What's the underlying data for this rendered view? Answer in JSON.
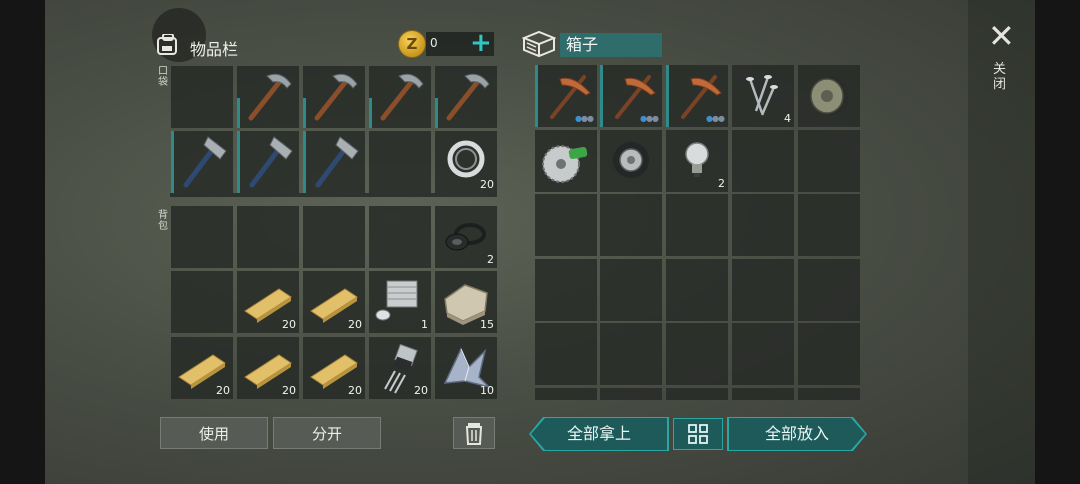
{
  "inventory": {
    "title": "物品栏",
    "coins": "0",
    "coin_symbol": "Z",
    "add_label": "+",
    "pocket_label": "口袋",
    "backpack_label": "背包",
    "use_label": "使用",
    "split_label": "分开",
    "pocket_slots": [
      {
        "icon": "empty-slot",
        "qty": ""
      },
      {
        "icon": "pickaxe-icon",
        "qty": ""
      },
      {
        "icon": "pickaxe-icon",
        "qty": ""
      },
      {
        "icon": "pickaxe-icon",
        "qty": ""
      },
      {
        "icon": "pickaxe-icon",
        "qty": ""
      },
      {
        "icon": "hatchet-icon",
        "qty": ""
      },
      {
        "icon": "hatchet-icon",
        "qty": ""
      },
      {
        "icon": "hatchet-icon",
        "qty": ""
      },
      {
        "icon": "empty-slot",
        "qty": ""
      },
      {
        "icon": "bearing-ring-icon",
        "qty": "20"
      }
    ],
    "backpack_slots": [
      {
        "icon": "empty-slot",
        "qty": ""
      },
      {
        "icon": "empty-slot",
        "qty": ""
      },
      {
        "icon": "empty-slot",
        "qty": ""
      },
      {
        "icon": "empty-slot",
        "qty": ""
      },
      {
        "icon": "rubber-seal-icon",
        "qty": "2"
      },
      {
        "icon": "empty-slot",
        "qty": ""
      },
      {
        "icon": "wood-plank-icon",
        "qty": "20"
      },
      {
        "icon": "wood-plank-icon",
        "qty": "20"
      },
      {
        "icon": "engine-cylinder-icon",
        "qty": "1"
      },
      {
        "icon": "stone-icon",
        "qty": "15"
      },
      {
        "icon": "wood-plank-icon",
        "qty": "20"
      },
      {
        "icon": "wood-plank-icon",
        "qty": "20"
      },
      {
        "icon": "wood-plank-icon",
        "qty": "20"
      },
      {
        "icon": "transistor-icon",
        "qty": "20"
      },
      {
        "icon": "metal-scrap-icon",
        "qty": "10"
      }
    ]
  },
  "box": {
    "title": "箱子",
    "take_all_label": "全部拿上",
    "put_all_label": "全部放入",
    "slots": [
      {
        "icon": "copper-pickaxe-icon",
        "qty": ""
      },
      {
        "icon": "copper-pickaxe-icon",
        "qty": ""
      },
      {
        "icon": "copper-pickaxe-icon",
        "qty": ""
      },
      {
        "icon": "nails-icon",
        "qty": "4"
      },
      {
        "icon": "brake-disc-icon",
        "qty": ""
      },
      {
        "icon": "saw-blade-icon",
        "qty": ""
      },
      {
        "icon": "tire-icon",
        "qty": ""
      },
      {
        "icon": "light-bulb-icon",
        "qty": "2"
      }
    ]
  },
  "window": {
    "close_symbol": "✕",
    "close_label": "关闭"
  },
  "colors": {
    "accent": "#2ec8c0",
    "teal_dark": "#1e5a5a",
    "box_name_bg": "#2f6c6c"
  }
}
